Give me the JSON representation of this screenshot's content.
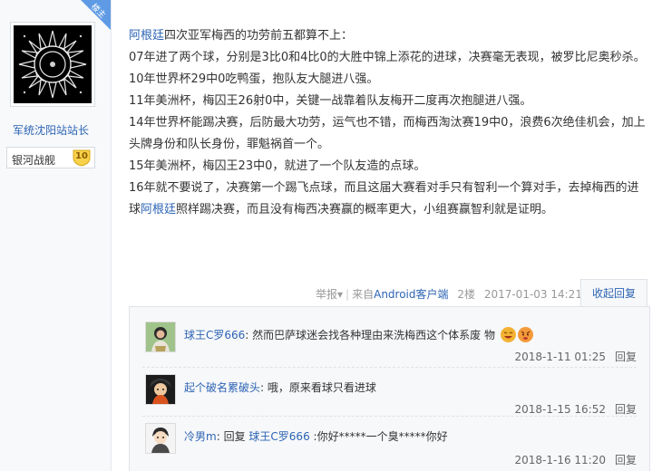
{
  "author": {
    "name": "军统沈阳站站长",
    "corner_tag": "楼主",
    "badge_name": "银河战舰",
    "badge_level": "10"
  },
  "post": {
    "line1_link": "阿根廷",
    "line1_rest": "四次亚军梅西的功劳前五都算不上：",
    "para2": "07年进了两个球，分别是3比0和4比0的大胜中锦上添花的进球，决赛毫无表现，被罗比尼奥秒杀。",
    "para3": "10年世界杯29中0吃鸭蛋，抱队友大腿进八强。",
    "para4": "11年美洲杯，梅囚王26射0中，关键一战靠着队友梅开二度再次抱腿进八强。",
    "para5": "14年世界杯能踢决赛，后防最大功劳，运气也不错，而梅西淘汰赛19中0，浪费6次绝佳机会，加上头牌身份和队长身份，罪魁祸首一个。",
    "para6": "15年美洲杯，梅囚王23中0，就进了一个队友造的点球。",
    "para7_a": "16年就不要说了，决赛第一个踢飞点球，而且这届大赛看对手只有智利一个算对手，去掉梅西的进球",
    "para7_link": "阿根廷",
    "para7_b": "照样踢决赛，而且没有梅西决赛赢的概率更大，小组赛赢智利就是证明。"
  },
  "meta": {
    "report": "举报",
    "report_caret": "▾",
    "source": "来自",
    "app": "Android客户端",
    "floor": "2楼",
    "time": "2017-01-03 14:21",
    "collapse": "收起回复"
  },
  "replies": [
    {
      "user": "球王C罗666",
      "colon": ":",
      "text": "然而巴萨球迷会找各种理由来洗梅西这个体系废 物",
      "time": "2018-1-11 01:25",
      "reply_label": "回复"
    },
    {
      "user": "起个破名累破头",
      "colon": ":",
      "text": "哦，原来看球只看进球",
      "time": "2018-1-15 16:52",
      "reply_label": "回复"
    },
    {
      "user": "冷男m",
      "colon": ":",
      "prefix": "回复",
      "target": "球王C罗666",
      "text": ":你好*****一个臭*****你好",
      "time": "2018-1-16 11:20",
      "reply_label": "回复"
    }
  ],
  "colors": {
    "link": "#2d64b3",
    "corner": "#5f9be4",
    "panel": "#f7f8fa"
  }
}
